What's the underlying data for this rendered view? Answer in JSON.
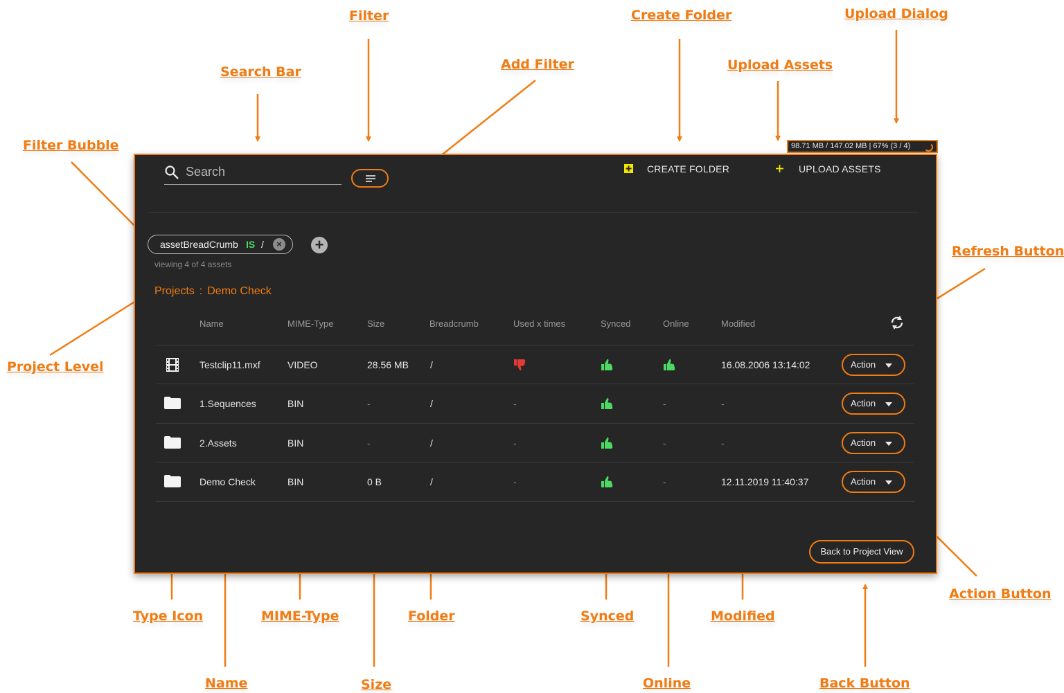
{
  "annotations": {
    "filter": "Filter",
    "create_folder": "Create Folder",
    "upload_dialog": "Upload Dialog",
    "search_bar": "Search Bar",
    "add_filter": "Add Filter",
    "upload_assets": "Upload Assets",
    "filter_bubble": "Filter Bubble",
    "refresh_button": "Refresh Button",
    "project_level": "Project Level",
    "action_button": "Action Button",
    "type_icon": "Type Icon",
    "mime_type": "MIME-Type",
    "folder": "Folder",
    "synced": "Synced",
    "modified": "Modified",
    "name": "Name",
    "size": "Size",
    "online": "Online",
    "back_button": "Back Button"
  },
  "upload_dialog": {
    "text": "98.71 MB / 147.02 MB | 67% (3 / 4)",
    "progress": 0.67
  },
  "search": {
    "placeholder": "Search"
  },
  "toolbar": {
    "create_folder": "CREATE FOLDER",
    "upload_assets": "UPLOAD ASSETS"
  },
  "filter_bubble": {
    "field": "assetBreadCrumb",
    "operator": "IS",
    "value": "/"
  },
  "viewing_count": "viewing 4 of 4 assets",
  "breadcrumb": {
    "root": "Projects",
    "separator": ":",
    "current": "Demo Check"
  },
  "table": {
    "headers": {
      "name": "Name",
      "mime": "MIME-Type",
      "size": "Size",
      "breadcrumb": "Breadcrumb",
      "used": "Used x times",
      "synced": "Synced",
      "online": "Online",
      "modified": "Modified"
    },
    "rows": [
      {
        "type_icon": "film-icon",
        "name": "Testclip11.mxf",
        "mime": "VIDEO",
        "size": "28.56 MB",
        "breadcrumb": "/",
        "used": "thumbs-down",
        "synced": "thumbs-up",
        "online": "thumbs-up",
        "modified": "16.08.2006 13:14:02",
        "action": "Action"
      },
      {
        "type_icon": "folder-icon",
        "name": "1.Sequences",
        "mime": "BIN",
        "size": "-",
        "breadcrumb": "/",
        "used": "-",
        "synced": "thumbs-up",
        "online": "-",
        "modified": "-",
        "action": "Action"
      },
      {
        "type_icon": "folder-icon",
        "name": "2.Assets",
        "mime": "BIN",
        "size": "-",
        "breadcrumb": "/",
        "used": "-",
        "synced": "thumbs-up",
        "online": "-",
        "modified": "-",
        "action": "Action"
      },
      {
        "type_icon": "folder-icon",
        "name": "Demo Check",
        "mime": "BIN",
        "size": "0 B",
        "breadcrumb": "/",
        "used": "-",
        "synced": "thumbs-up",
        "online": "-",
        "modified": "12.11.2019 11:40:37",
        "action": "Action"
      }
    ]
  },
  "back_button": "Back to Project View",
  "colors": {
    "accent": "#f07c13",
    "panel": "#262626",
    "success": "#4cd964",
    "danger": "#e53935",
    "create_folder_icon": "#f2e600"
  }
}
